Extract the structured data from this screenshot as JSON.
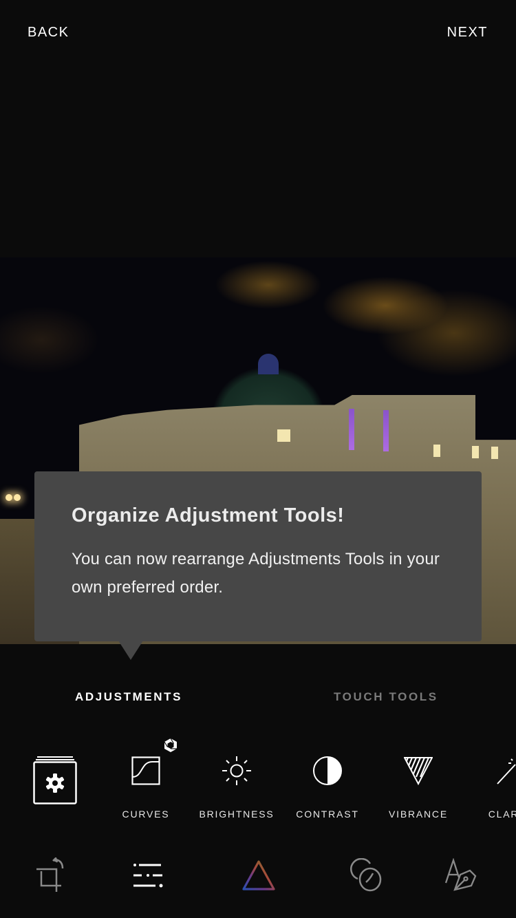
{
  "topbar": {
    "back_label": "BACK",
    "next_label": "NEXT"
  },
  "tooltip": {
    "title": "Organize Adjustment Tools!",
    "body": "You can now rearrange Adjustments Tools in your own preferred order."
  },
  "tabs": [
    {
      "label": "ADJUSTMENTS",
      "active": true
    },
    {
      "label": "TOUCH TOOLS",
      "active": false
    }
  ],
  "tools": {
    "manage": {
      "icon": "gear-icon"
    },
    "items": [
      {
        "label": "CURVES",
        "icon": "curves-icon",
        "badge": "premium-hexagon-icon"
      },
      {
        "label": "BRIGHTNESS",
        "icon": "sun-icon"
      },
      {
        "label": "CONTRAST",
        "icon": "half-circle-icon"
      },
      {
        "label": "VIBRANCE",
        "icon": "striped-triangle-icon"
      },
      {
        "label": "CLAR",
        "icon": "magic-wand-icon"
      }
    ]
  },
  "bottom_nav": [
    {
      "name": "crop-rotate",
      "icon": "crop-rotate-icon",
      "active": false
    },
    {
      "name": "adjustments",
      "icon": "sliders-icon",
      "active": true
    },
    {
      "name": "filters",
      "icon": "prism-triangle-icon",
      "active": false
    },
    {
      "name": "overlays",
      "icon": "overlay-circles-icon",
      "active": false
    },
    {
      "name": "text-draw",
      "icon": "text-pen-icon",
      "active": false
    }
  ],
  "colors": {
    "background": "#0b0b0b",
    "tooltip_bg": "#474747",
    "inactive_tab": "#7a7a7a",
    "inactive_icon": "#8a8a8a"
  }
}
